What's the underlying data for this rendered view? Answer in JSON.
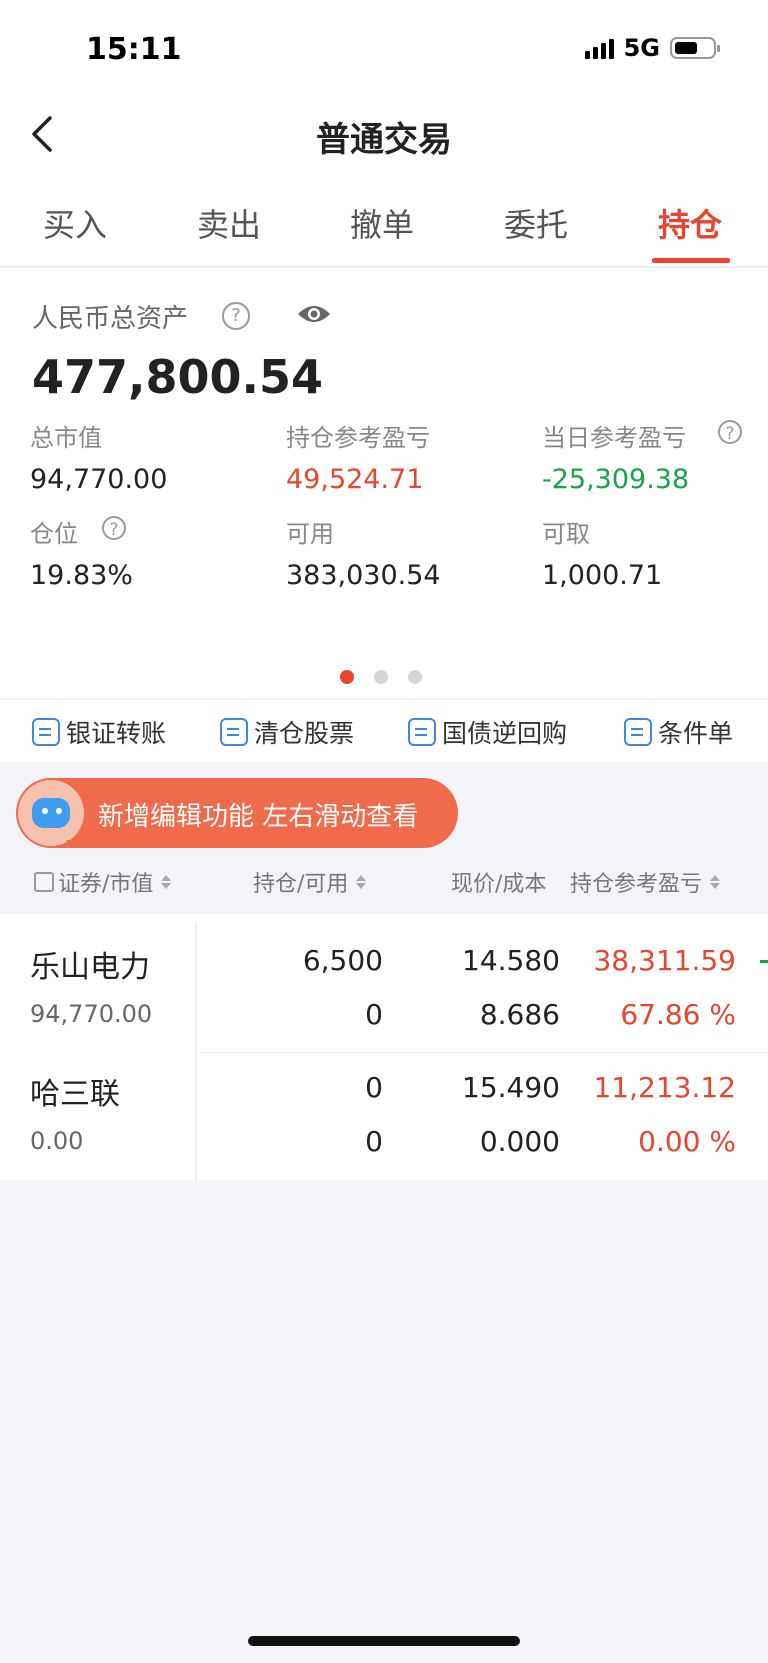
{
  "status": {
    "time": "15:11",
    "network": "5G"
  },
  "header": {
    "title": "普通交易"
  },
  "tabs": [
    {
      "label": "买入"
    },
    {
      "label": "卖出"
    },
    {
      "label": "撤单"
    },
    {
      "label": "委托"
    },
    {
      "label": "持仓",
      "active": true
    }
  ],
  "assets": {
    "total_label": "人民币总资产",
    "total_value": "477,800.54",
    "metrics": {
      "market_value": {
        "label": "总市值",
        "value": "94,770.00"
      },
      "position_pl": {
        "label": "持仓参考盈亏",
        "value": "49,524.71"
      },
      "day_pl": {
        "label": "当日参考盈亏",
        "value": "-25,309.38"
      },
      "position_ratio": {
        "label": "仓位",
        "value": "19.83%"
      },
      "available": {
        "label": "可用",
        "value": "383,030.54"
      },
      "withdrawable": {
        "label": "可取",
        "value": "1,000.71"
      }
    }
  },
  "quick_actions": [
    {
      "label": "银证转账",
      "icon": "transfer-icon"
    },
    {
      "label": "清仓股票",
      "icon": "chart-icon"
    },
    {
      "label": "国债逆回购",
      "icon": "repo-icon"
    },
    {
      "label": "条件单",
      "icon": "condition-order-icon"
    }
  ],
  "banner": {
    "text": "新增编辑功能 左右滑动查看"
  },
  "table": {
    "headers": {
      "security": "证券/市值",
      "position": "持仓/可用",
      "price": "现价/成本",
      "pl": "持仓参考盈亏"
    },
    "rows": [
      {
        "name": "乐山电力",
        "market_value": "94,770.00",
        "position": "6,500",
        "available": "0",
        "price": "14.580",
        "cost": "8.686",
        "pl": "38,311.59",
        "pl_pct": "67.86 %"
      },
      {
        "name": "哈三联",
        "market_value": "0.00",
        "position": "0",
        "available": "0",
        "price": "15.490",
        "cost": "0.000",
        "pl": "11,213.12",
        "pl_pct": "0.00 %"
      }
    ]
  },
  "colors": {
    "accent": "#e8452f",
    "gain": "#e8452f",
    "loss": "#1aa24a",
    "link": "#3f87e6"
  }
}
